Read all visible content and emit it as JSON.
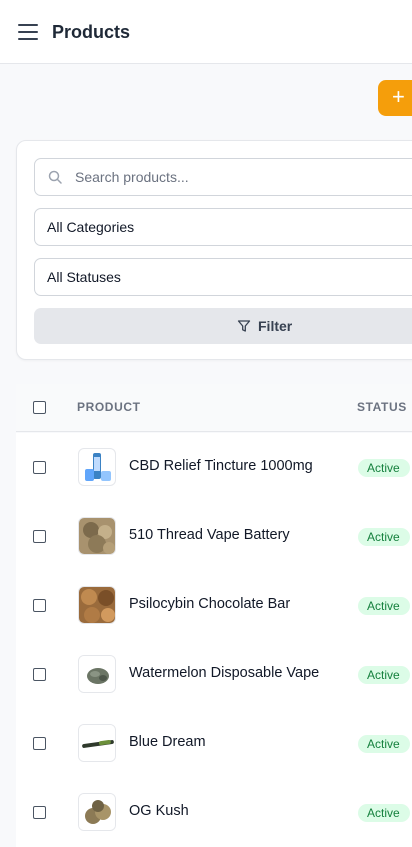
{
  "header": {
    "title": "Products"
  },
  "actions": {
    "add_label": "+"
  },
  "filters": {
    "search_placeholder": "Search products...",
    "category_value": "All Categories",
    "status_value": "All Statuses",
    "filter_label": "Filter"
  },
  "table": {
    "columns": {
      "product": "PRODUCT",
      "status": "STATUS"
    },
    "rows": [
      {
        "name": "CBD Relief Tincture 1000mg",
        "status": "Active",
        "thumb": "tincture"
      },
      {
        "name": "510 Thread Vape Battery",
        "status": "Active",
        "thumb": "flower"
      },
      {
        "name": "Psilocybin Chocolate Bar",
        "status": "Active",
        "thumb": "flower-gold"
      },
      {
        "name": "Watermelon Disposable Vape",
        "status": "Active",
        "thumb": "nug"
      },
      {
        "name": "Blue Dream",
        "status": "Active",
        "thumb": "pen"
      },
      {
        "name": "OG Kush",
        "status": "Active",
        "thumb": "flower-small"
      }
    ]
  },
  "colors": {
    "accent": "#f59e0b",
    "status_active_bg": "#dcfce7",
    "status_active_text": "#15803d"
  }
}
